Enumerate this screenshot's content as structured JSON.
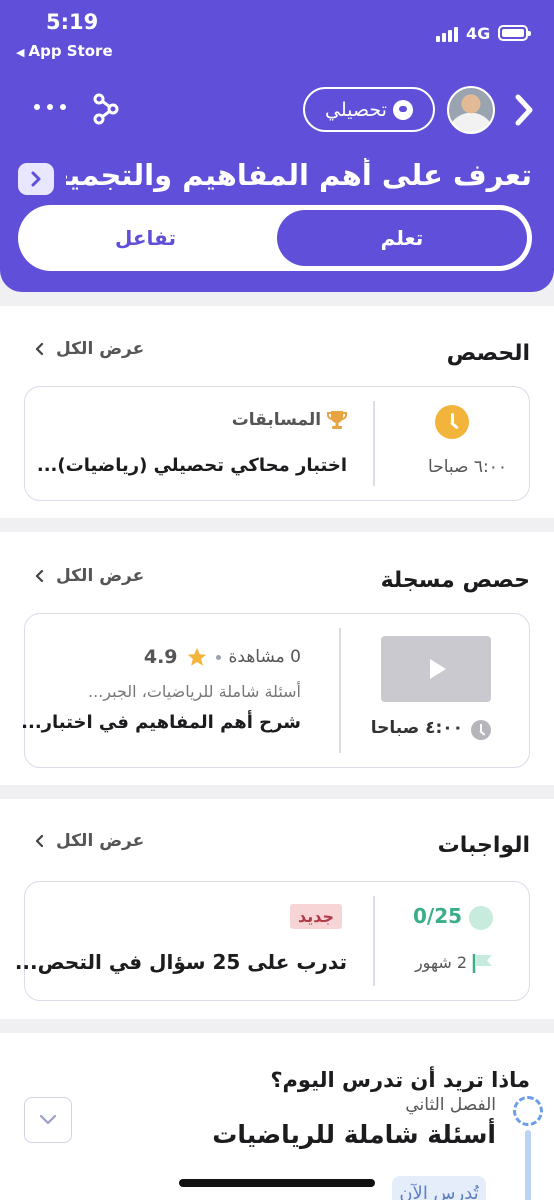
{
  "status_bar": {
    "time": "5:19",
    "back_app": "App Store",
    "network": "4G"
  },
  "header": {
    "subject_chip": "تحصيلي",
    "title": "تعرف على أهم المفاهيم والتجميعا...",
    "tabs": [
      {
        "label": "تعلم",
        "active": true
      },
      {
        "label": "تفاعل",
        "active": false
      }
    ]
  },
  "sections": {
    "classes": {
      "title": "الحصص",
      "view_all": "عرض الكل",
      "card": {
        "time": "٦:٠٠ صباحا",
        "category": "المسابقات",
        "name": "اختبار محاكي تحصيلي (رياضيات)..."
      }
    },
    "recorded": {
      "title": "حصص مسجلة",
      "view_all": "عرض الكل",
      "card": {
        "time": "٤:٠٠ صباحا",
        "views": "0 مشاهدة",
        "rating": "4.9",
        "course": "أسئلة شاملة للرياضيات، الجبر...",
        "name": "شرح أهم المفاهيم في اختبار..."
      }
    },
    "homework": {
      "title": "الواجبات",
      "view_all": "عرض الكل",
      "card": {
        "progress": "0/25",
        "duration": "2 شهور",
        "badge": "جديد",
        "name": "تدرب على 25 سؤال في التحص..."
      }
    },
    "study_today": {
      "question": "ماذا تريد أن تدرس اليوم؟",
      "term": "الفصل الثاني",
      "subject": "أسئلة شاملة للرياضيات",
      "action": "تُدرس الآن"
    }
  },
  "colors": {
    "primary": "#5f4fd9",
    "accent_yellow": "#f2b43a",
    "success": "#3aae86",
    "badge_bg": "#f7d4d6"
  }
}
